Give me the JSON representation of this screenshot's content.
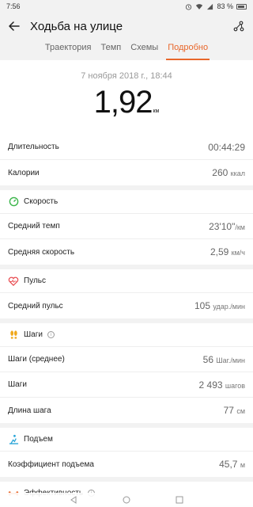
{
  "status": {
    "time": "7:56",
    "battery": "83 %"
  },
  "header": {
    "title": "Ходьба на улице"
  },
  "tabs": [
    "Траектория",
    "Темп",
    "Схемы",
    "Подробно"
  ],
  "summary": {
    "date": "7 ноября 2018 г., 18:44",
    "distance": "1,92",
    "distance_unit": "км",
    "rows": [
      {
        "label": "Длительность",
        "value": "00:44:29",
        "unit": ""
      },
      {
        "label": "Калории",
        "value": "260",
        "unit": "ккал"
      }
    ]
  },
  "speed": {
    "title": "Скорость",
    "rows": [
      {
        "label": "Средний темп",
        "value": "23'10\"",
        "unit": "/км"
      },
      {
        "label": "Средняя скорость",
        "value": "2,59",
        "unit": "км/ч"
      }
    ]
  },
  "pulse": {
    "title": "Пульс",
    "rows": [
      {
        "label": "Средний пульс",
        "value": "105",
        "unit": "удар./мин"
      }
    ]
  },
  "steps": {
    "title": "Шаги",
    "rows": [
      {
        "label": "Шаги (среднее)",
        "value": "56",
        "unit": "Шаг./мин"
      },
      {
        "label": "Шаги",
        "value": "2 493",
        "unit": "шагов"
      },
      {
        "label": "Длина шага",
        "value": "77",
        "unit": "см"
      }
    ]
  },
  "climb": {
    "title": "Подъем",
    "rows": [
      {
        "label": "Коэффициент подъема",
        "value": "45,7",
        "unit": "м"
      }
    ]
  },
  "efficiency": {
    "title": "Эффективность"
  },
  "colors": {
    "accent": "#e8672b",
    "speed_icon": "#3bb54a",
    "pulse_icon": "#e8464b",
    "steps_icon": "#f0a81c",
    "climb_icon": "#2aa5d8",
    "eff_icon": "#e8672b"
  }
}
